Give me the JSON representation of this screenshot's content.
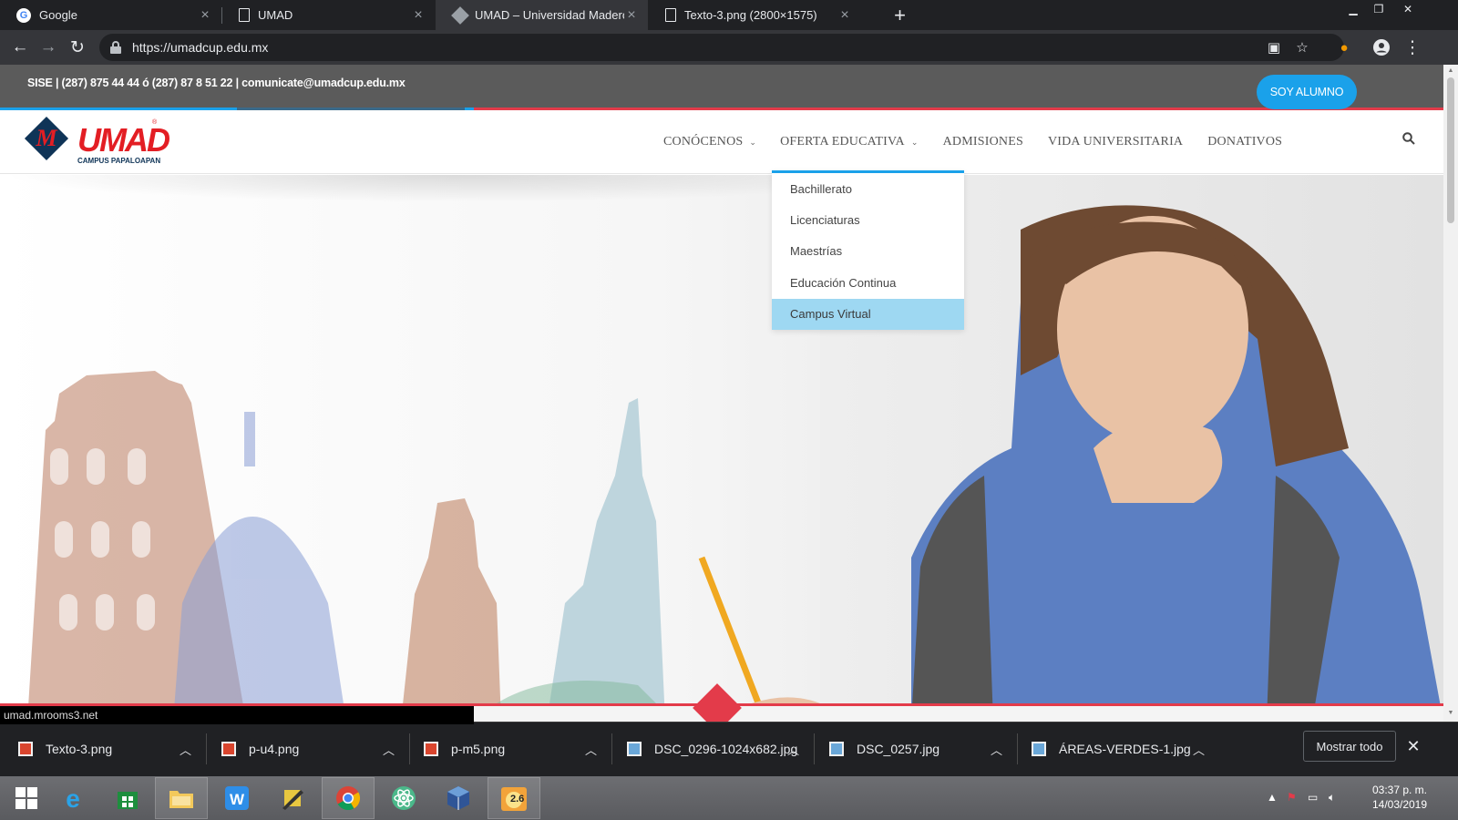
{
  "browser": {
    "tabs": [
      {
        "title": "Google",
        "active": false,
        "favicon": "google-icon"
      },
      {
        "title": "UMAD",
        "active": false,
        "favicon": "document-icon"
      },
      {
        "title": "UMAD – Universidad Madero Ca",
        "active": true,
        "favicon": "umad-favicon-icon"
      },
      {
        "title": "Texto-3.png (2800×1575)",
        "active": false,
        "favicon": "document-icon"
      }
    ],
    "url": "https://umadcup.edu.mx"
  },
  "site": {
    "topbar_text": "SISE | (287) 875 44 44 ó (287) 87 8 51 22  |  comunicate@umadcup.edu.mx",
    "logo": {
      "wordmark": "UMAD",
      "letter": "M",
      "subtitle": "CAMPUS PAPALOAPAN",
      "reg": "®"
    },
    "nav": [
      {
        "label": "CONÓCENOS",
        "has_caret": true
      },
      {
        "label": "OFERTA EDUCATIVA",
        "has_caret": true
      },
      {
        "label": "ADMISIONES",
        "has_caret": false
      },
      {
        "label": "VIDA UNIVERSITARIA",
        "has_caret": false
      },
      {
        "label": "DONATIVOS",
        "has_caret": false
      }
    ],
    "cta_label": "SOY ALUMNO",
    "dropdown": [
      {
        "label": "Bachillerato"
      },
      {
        "label": "Licenciaturas"
      },
      {
        "label": "Maestrías"
      },
      {
        "label": "Educación Continua"
      },
      {
        "label": "Campus Virtual",
        "hover": true
      }
    ],
    "accent_blue": "#1aa1ea",
    "accent_red": "#e33b4a"
  },
  "status_bar": {
    "text": "umad.mrooms3.net"
  },
  "downloads": {
    "items": [
      {
        "name": "Texto-3.png",
        "type": "png"
      },
      {
        "name": "p-u4.png",
        "type": "png"
      },
      {
        "name": "p-m5.png",
        "type": "png"
      },
      {
        "name": "DSC_0296-1024x682.jpg",
        "type": "jpg"
      },
      {
        "name": "DSC_0257.jpg",
        "type": "jpg"
      },
      {
        "name": "ÁREAS-VERDES-1.jpg",
        "type": "jpg"
      }
    ],
    "show_all_label": "Mostrar todo"
  },
  "taskbar": {
    "time": "03:37 p. m.",
    "date": "14/03/2019",
    "apps": [
      "start-icon",
      "internet-explorer-icon",
      "store-icon",
      "file-explorer-icon",
      "wps-writer-icon",
      "pencil-app-icon",
      "chrome-icon",
      "atom-icon",
      "virtualbox-icon",
      "app-2-6-icon"
    ],
    "badge": "2.6"
  }
}
